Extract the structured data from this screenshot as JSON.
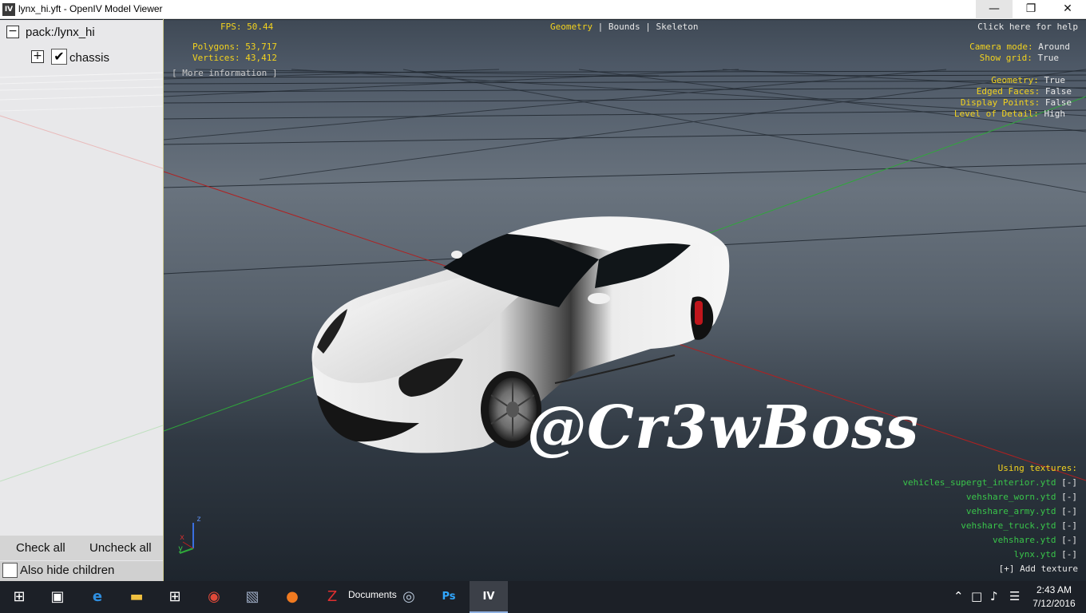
{
  "window": {
    "app_icon": "IV",
    "title": "lynx_hi.yft - OpenIV Model Viewer",
    "minimize_icon": "minimize-icon",
    "maximize_icon": "maximize-icon",
    "close_icon": "close-icon"
  },
  "tree": {
    "root_label": "pack:/lynx_hi",
    "child_label": "chassis",
    "child_checked": true
  },
  "panel": {
    "check_all": "Check all",
    "uncheck_all": "Uncheck all",
    "also_hide_children": "Also hide children"
  },
  "viewport": {
    "fps": "FPS: 50.44",
    "polygons": "Polygons: 53,717",
    "vertices": "Vertices: 43,412",
    "more_info": "[ More information ]",
    "tabs": [
      {
        "label": "Geometry",
        "active": true
      },
      {
        "label": "Bounds",
        "active": false
      },
      {
        "label": "Skeleton",
        "active": false
      }
    ],
    "tab_separator": "|",
    "help": "Click here for help",
    "settings": [
      {
        "label": "Camera mode:",
        "value": "Around"
      },
      {
        "label": "Show grid:",
        "value": "True"
      },
      {
        "label": "Geometry:",
        "value": "True"
      },
      {
        "label": "Edged Faces:",
        "value": "False"
      },
      {
        "label": "Display Points:",
        "value": "False"
      },
      {
        "label": "Level of Detail:",
        "value": "High"
      }
    ],
    "textures_header": "Using textures:",
    "textures": [
      "vehicles_supergt_interior.ytd",
      "vehshare_worn.ytd",
      "vehshare_army.ytd",
      "vehshare_truck.ytd",
      "vehshare.ytd",
      "lynx.ytd"
    ],
    "texture_remove": "[-]",
    "add_texture": "[+] Add texture",
    "watermark": "@Cr3wBoss",
    "axis_labels": {
      "x": "x",
      "y": "y",
      "z": "z"
    }
  },
  "taskbar": {
    "documents_label": "Documents",
    "time": "2:43 AM",
    "date": "7/12/2016"
  },
  "colors": {
    "overlay_yellow": "#f2d21e",
    "texture_green": "#39c44a",
    "grid_red_axis": "#b02020",
    "grid_green_axis": "#2fa83a"
  }
}
